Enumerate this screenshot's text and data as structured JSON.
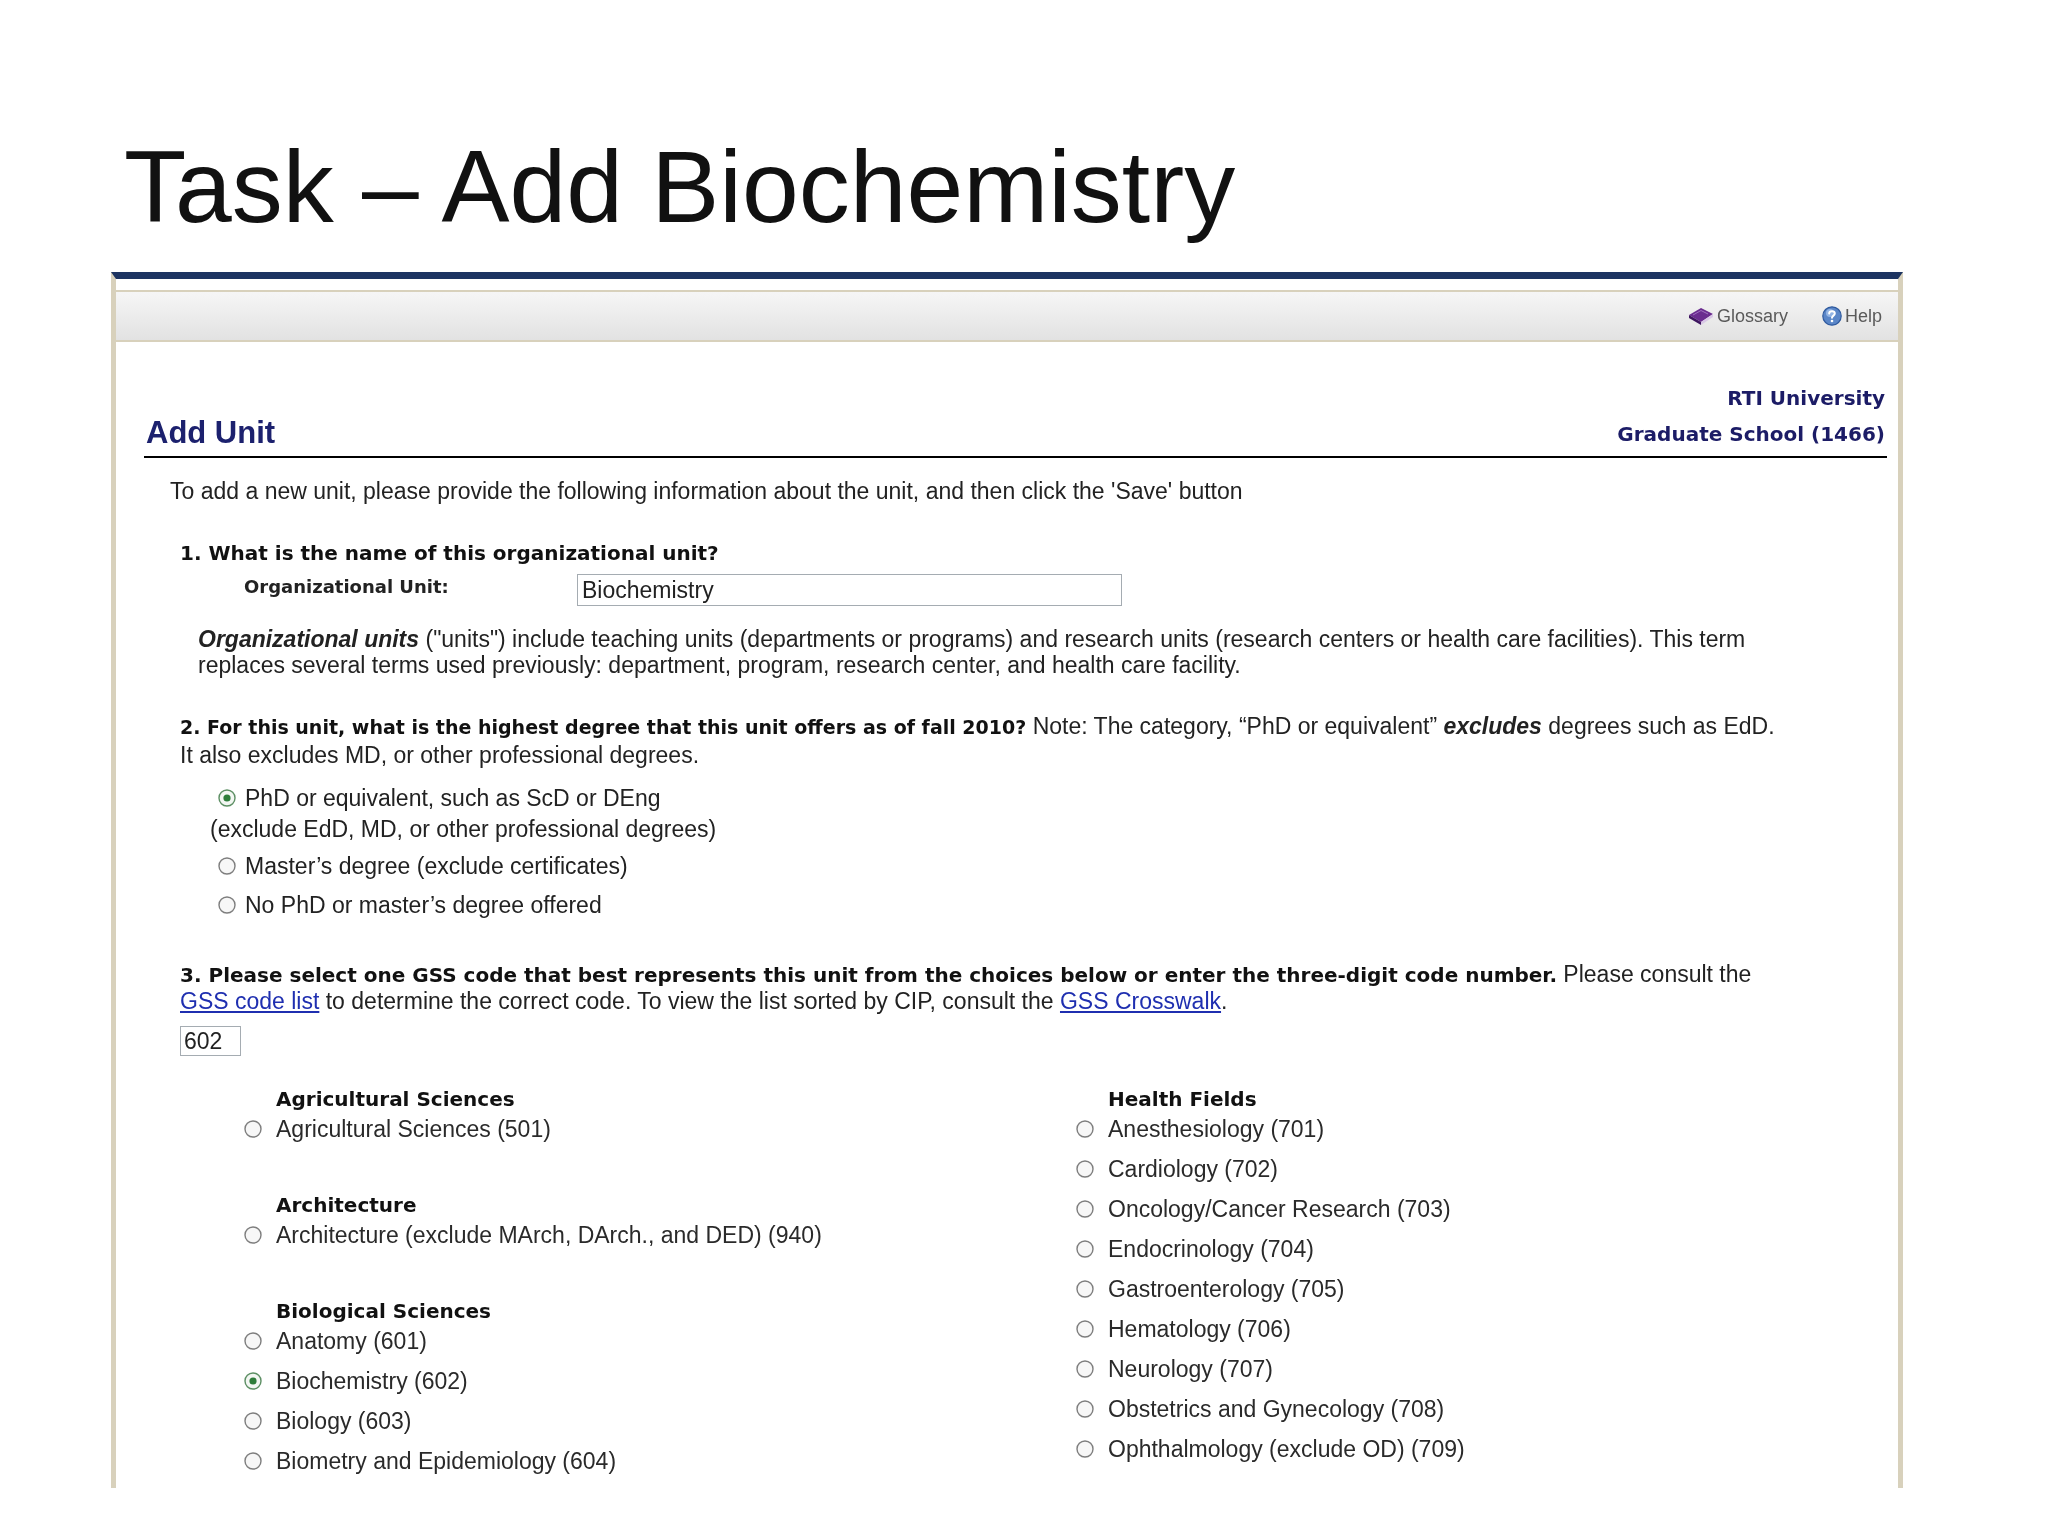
{
  "slide": {
    "title": "Task – Add Biochemistry"
  },
  "toolbar": {
    "links": [
      {
        "kind": "glossary",
        "label": "Glossary"
      },
      {
        "kind": "help",
        "label": "Help"
      }
    ]
  },
  "header": {
    "title": "Add Unit",
    "institution": "RTI University",
    "school": "Graduate School (1466)"
  },
  "intro": "To add a new unit, please provide the following information about the unit, and then click the 'Save' button",
  "question_1": {
    "prompt": "1. What is the name of this organizational unit?",
    "field_label": "Organizational Unit:",
    "value": "Biochemistry",
    "note": "**Organizational units** (\"units\") include teaching units (departments or programs) and research units (research centers or health care facilities). This term replaces several terms used previously: department, program, research center, and health care facility."
  },
  "question_2": {
    "prompt": "**2. For this unit, what is the highest degree that this unit offers as of fall 2010?** Note: The category, “PhD or equivalent” *excludes* degrees such as EdD. It also excludes MD, or other professional degrees.",
    "options": [
      {
        "label": "PhD or equivalent, such as ScD or DEng",
        "detail": "(exclude EdD, MD, or other professional degrees)",
        "selected": true
      },
      {
        "label": "Master’s degree (exclude certificates)",
        "selected": false
      },
      {
        "label": "No PhD or master’s degree offered",
        "selected": false
      }
    ]
  },
  "question_3": {
    "prompt": [
      {
        "kind": "text",
        "text": "**3. Please select one GSS code that best represents this unit from the choices below or enter the three-digit code number.** Please consult the "
      },
      {
        "kind": "link",
        "text": "GSS code list"
      },
      {
        "kind": "text",
        "text": " to determine the correct code. To view the list sorted by CIP, consult the "
      },
      {
        "kind": "link",
        "text": "GSS Crosswalk"
      },
      {
        "kind": "text",
        "text": "."
      }
    ],
    "code_value": "602",
    "columns": [
      {
        "groups": [
          {
            "heading": "Agricultural Sciences",
            "options": [
              {
                "label": "Agricultural Sciences (501)",
                "selected": false
              }
            ]
          },
          {
            "heading": "Architecture",
            "options": [
              {
                "label": "Architecture (exclude MArch, DArch., and DED) (940)",
                "selected": false
              }
            ]
          },
          {
            "heading": "Biological Sciences",
            "options": [
              {
                "label": "Anatomy (601)",
                "selected": false
              },
              {
                "label": "Biochemistry (602)",
                "selected": true
              },
              {
                "label": "Biology (603)",
                "selected": false
              },
              {
                "label": "Biometry and Epidemiology (604)",
                "selected": false
              }
            ]
          }
        ]
      },
      {
        "groups": [
          {
            "heading": "Health Fields",
            "options": [
              {
                "label": "Anesthesiology (701)",
                "selected": false
              },
              {
                "label": "Cardiology (702)",
                "selected": false
              },
              {
                "label": "Oncology/Cancer Research (703)",
                "selected": false
              },
              {
                "label": "Endocrinology (704)",
                "selected": false
              },
              {
                "label": "Gastroenterology (705)",
                "selected": false
              },
              {
                "label": "Hematology (706)",
                "selected": false
              },
              {
                "label": "Neurology (707)",
                "selected": false
              },
              {
                "label": "Obstetrics and Gynecology (708)",
                "selected": false
              },
              {
                "label": "Ophthalmology (exclude OD) (709)",
                "selected": false
              }
            ]
          }
        ]
      }
    ]
  }
}
